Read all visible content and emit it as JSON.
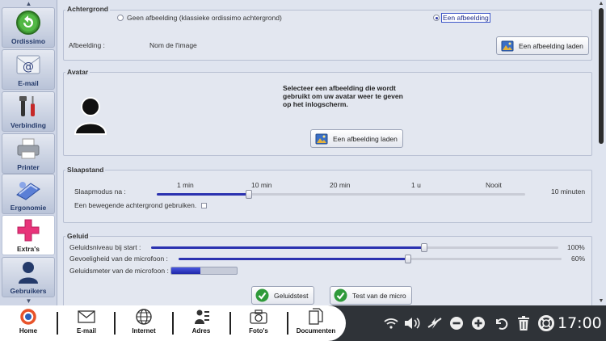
{
  "sidebar": {
    "items": [
      {
        "label": "Ordissimo"
      },
      {
        "label": "E-mail"
      },
      {
        "label": "Verbinding"
      },
      {
        "label": "Printer"
      },
      {
        "label": "Ergonomie"
      },
      {
        "label": "Extra's"
      },
      {
        "label": "Gebruikers"
      }
    ]
  },
  "background": {
    "title": "Achtergrond",
    "option_none": "Geen afbeelding (klassieke ordissimo achtergrond)",
    "option_image": "Een afbeelding",
    "image_label": "Afbeelding :",
    "image_name": "Nom de l'image",
    "load_button": "Een afbeelding laden"
  },
  "avatar": {
    "title": "Avatar",
    "description": "Selecteer een afbeelding die wordt gebruikt om uw avatar weer te geven op het inlogscherm.",
    "load_button": "Een afbeelding laden"
  },
  "sleep": {
    "title": "Slaapstand",
    "mode_label": "Slaapmodus na :",
    "ticks": [
      "1 min",
      "10 min",
      "20 min",
      "1 u",
      "Nooit"
    ],
    "value_text": "10 minuten",
    "value_fraction": 0.25,
    "moving_bg_label": "Een bewegende achtergrond gebruiken."
  },
  "sound": {
    "title": "Geluid",
    "volume_label": "Geluidsniveau bij start :",
    "volume_value": "100%",
    "volume_fraction": 0.67,
    "mic_label": "Gevoeligheid van de microfoon :",
    "mic_value": "60%",
    "mic_fraction": 0.6,
    "meter_label": "Geluidsmeter van de microfoon :",
    "meter_fraction": 0.45,
    "test_sound_button": "Geluidstest",
    "test_mic_button": "Test van de micro"
  },
  "taskbar": {
    "items": [
      {
        "label": "Home",
        "icon": "ordissimo-logo-icon"
      },
      {
        "label": "E-mail",
        "icon": "envelope-icon"
      },
      {
        "label": "Internet",
        "icon": "globe-icon"
      },
      {
        "label": "Adres",
        "icon": "contacts-icon"
      },
      {
        "label": "Foto's",
        "icon": "camera-icon"
      },
      {
        "label": "Documenten",
        "icon": "documents-icon"
      }
    ],
    "clock": "17:00"
  },
  "colors": {
    "accent": "#2b32b0",
    "taskbar_dark": "#2f3338",
    "panel": "#e3e7f0",
    "extras_pink": "#e8337a"
  }
}
